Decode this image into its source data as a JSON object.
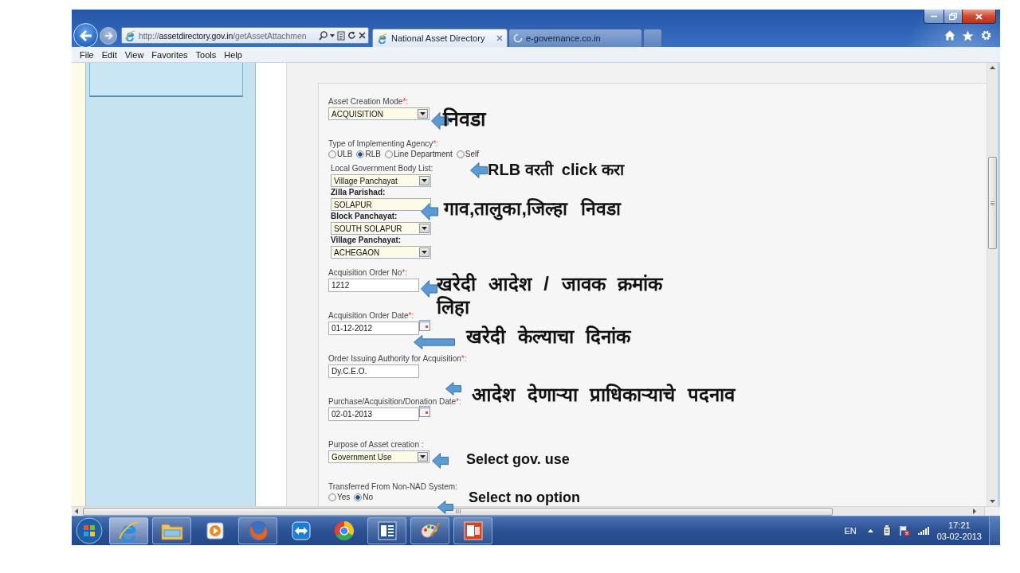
{
  "browser": {
    "url": {
      "scheme": "http://",
      "domain": "assetdirectory.gov.in",
      "path": "/getAssetAttachmen"
    },
    "tabs": [
      {
        "label": "National Asset Directory",
        "selected": true
      },
      {
        "label": "e-governance.co.in",
        "selected": false
      }
    ],
    "menu": [
      "File",
      "Edit",
      "View",
      "Favorites",
      "Tools",
      "Help"
    ]
  },
  "form": {
    "fields": [
      {
        "kind": "select",
        "label": "Asset Creation Mode",
        "mark": "*:",
        "value": "ACQUISITION",
        "arrow_button": true
      },
      {
        "kind": "radio",
        "label": "Type of Implementing Agency",
        "mark": "*:",
        "options": [
          {
            "label": "ULB",
            "selected": false
          },
          {
            "label": "RLB",
            "selected": true
          },
          {
            "label": "Line Department",
            "selected": false
          },
          {
            "label": "Self",
            "selected": false
          }
        ],
        "children": [
          {
            "kind": "select",
            "label": "Local Government Body List:",
            "bold": false,
            "value": "Village Panchayat",
            "arrow_button": true
          },
          {
            "kind": "select",
            "label": "Zilla Parishad:",
            "bold": true,
            "value": "SOLAPUR",
            "arrow_button": false
          },
          {
            "kind": "select",
            "label": "Block Panchayat:",
            "bold": true,
            "value": "SOUTH SOLAPUR",
            "arrow_button": true
          },
          {
            "kind": "select",
            "label": "Village Panchayat:",
            "bold": true,
            "value": "ACHEGAON",
            "arrow_button": true
          }
        ]
      },
      {
        "kind": "text",
        "label": "Acquisition Order No",
        "mark": "*:",
        "value": "1212"
      },
      {
        "kind": "date",
        "label": "Acquisition Order Date",
        "mark": "*:",
        "value": "01-12-2012"
      },
      {
        "kind": "text",
        "label": "Order Issuing Authority for Acquisition",
        "mark": "*:",
        "value": "Dy.C.E.O."
      },
      {
        "kind": "date",
        "label": "Purchase/Acquisition/Donation Date",
        "mark": "*:",
        "value": "02-01-2013"
      },
      {
        "kind": "select",
        "label": "Purpose of Asset creation :",
        "value": "Government Use",
        "arrow_button": true
      },
      {
        "kind": "radio",
        "label": "Transferred From Non-NAD System:",
        "options": [
          {
            "label": "Yes",
            "selected": false
          },
          {
            "label": "No",
            "selected": true
          }
        ]
      }
    ]
  },
  "annotations": [
    {
      "text": "निवडा"
    },
    {
      "text": "RLB वरती  click करा"
    },
    {
      "text": "गाव,तालुका,जिल्हा  निवडा"
    },
    {
      "text": "खरेदी आदेश / जावक क्रमांक लिहा"
    },
    {
      "text": "खरेदी केल्याचा दिनांक"
    },
    {
      "text": "आदेश देणाऱ्या प्राधिकाऱ्याचे पदनाव"
    },
    {
      "text": "Select gov. use"
    },
    {
      "text": "Select no option"
    }
  ],
  "taskbar": {
    "apps": [
      {
        "kind": "browser",
        "running": true,
        "selected": true
      },
      {
        "kind": "folder",
        "running": true,
        "selected": false
      },
      {
        "kind": "media",
        "running": false,
        "selected": false
      },
      {
        "kind": "firefox",
        "running": true,
        "selected": false
      },
      {
        "kind": "remote",
        "running": false,
        "selected": false
      },
      {
        "kind": "chrome",
        "running": false,
        "selected": false
      },
      {
        "kind": "word",
        "running": true,
        "selected": false
      },
      {
        "kind": "paint",
        "running": true,
        "selected": false
      },
      {
        "kind": "slides",
        "running": true,
        "selected": false
      }
    ],
    "language": "EN",
    "time": "17:21",
    "date": "03-02-2013"
  }
}
